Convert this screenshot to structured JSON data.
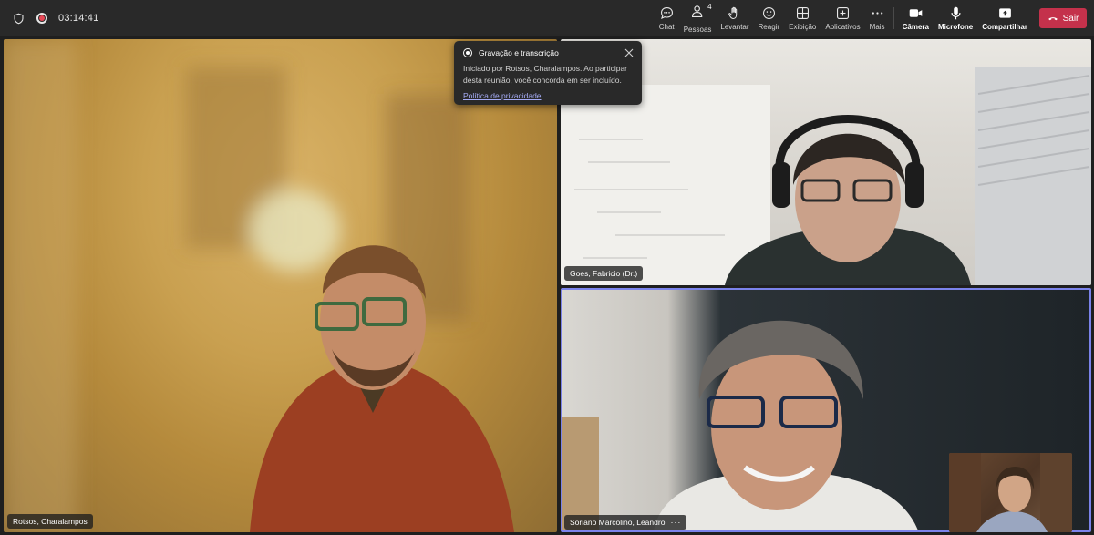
{
  "meeting": {
    "timer": "03:14:41"
  },
  "toolbar": {
    "chat_label": "Chat",
    "people_label": "Pessoas",
    "people_count": "4",
    "raise_label": "Levantar",
    "react_label": "Reagir",
    "view_label": "Exibição",
    "apps_label": "Aplicativos",
    "more_label": "Mais",
    "camera_label": "Câmera",
    "mic_label": "Microfone",
    "share_label": "Compartilhar",
    "leave_label": "Sair"
  },
  "notification": {
    "title": "Gravação e transcrição",
    "body": "Iniciado por Rotsos, Charalampos. Ao participar desta reunião, você concorda em ser incluído.",
    "link": "Política de privacidade"
  },
  "participants": {
    "main": "Rotsos, Charalampos",
    "top_right": "Goes, Fabricio (Dr.)",
    "bottom_right": "Soriano Marcolino, Leandro",
    "bottom_right_more": "···"
  },
  "colors": {
    "leave": "#c4314b",
    "active_speaker_border": "#7b83eb",
    "recording": "#e74856"
  }
}
